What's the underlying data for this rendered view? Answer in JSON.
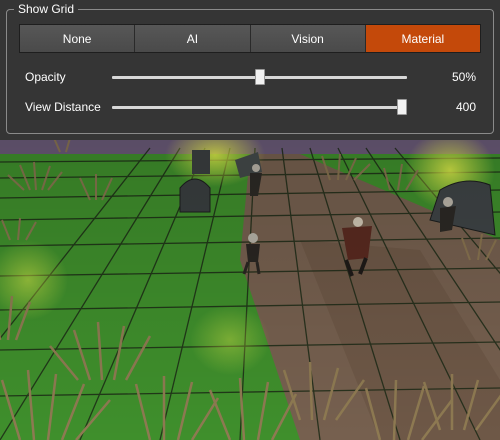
{
  "panel": {
    "title": "Show Grid",
    "modes": [
      {
        "label": "None",
        "active": false
      },
      {
        "label": "AI",
        "active": false
      },
      {
        "label": "Vision",
        "active": false
      },
      {
        "label": "Material",
        "active": true
      }
    ],
    "sliders": [
      {
        "label": "Opacity",
        "value_text": "50%",
        "value": 0.5
      },
      {
        "label": "View Distance",
        "value_text": "400",
        "value": 1.0
      }
    ]
  },
  "colors": {
    "panel_bg": "#353535",
    "button_bg": "#4f4f4f",
    "active_button": "#c4490a",
    "grid_green": "#4fa83a",
    "grid_dirt": "#7d6553"
  }
}
